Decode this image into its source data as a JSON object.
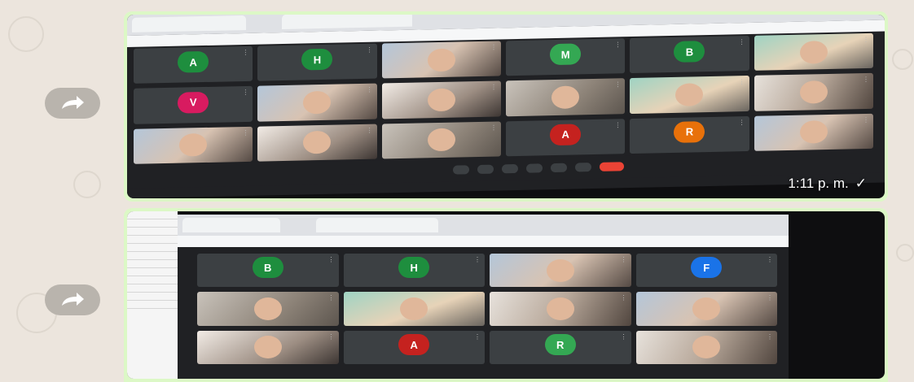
{
  "messages": [
    {
      "time": "1:11 p. m.",
      "status_icon": "check-icon",
      "meeting": {
        "tiles": [
          {
            "type": "avatar",
            "letter": "A",
            "color": "#1e8e3e"
          },
          {
            "type": "avatar",
            "letter": "H",
            "color": "#1e8e3e"
          },
          {
            "type": "video"
          },
          {
            "type": "avatar",
            "letter": "M",
            "color": "#34a853"
          },
          {
            "type": "avatar",
            "letter": "B",
            "color": "#1e8e3e"
          },
          {
            "type": "video"
          },
          {
            "type": "avatar",
            "letter": "V",
            "color": "#d81b60"
          },
          {
            "type": "video"
          },
          {
            "type": "video"
          },
          {
            "type": "video"
          },
          {
            "type": "video"
          },
          {
            "type": "video"
          },
          {
            "type": "video"
          },
          {
            "type": "video"
          },
          {
            "type": "video"
          },
          {
            "type": "avatar",
            "letter": "A",
            "color": "#c5221f"
          },
          {
            "type": "avatar",
            "letter": "R",
            "color": "#e8710a"
          },
          {
            "type": "video"
          }
        ]
      }
    },
    {
      "meeting": {
        "tiles": [
          {
            "type": "avatar",
            "letter": "B",
            "color": "#1e8e3e"
          },
          {
            "type": "avatar",
            "letter": "H",
            "color": "#1e8e3e"
          },
          {
            "type": "video"
          },
          {
            "type": "avatar",
            "letter": "F",
            "color": "#1a73e8"
          },
          {
            "type": "video"
          },
          {
            "type": "video"
          },
          {
            "type": "video"
          },
          {
            "type": "video"
          },
          {
            "type": "video"
          },
          {
            "type": "avatar",
            "letter": "A",
            "color": "#c5221f"
          },
          {
            "type": "avatar",
            "letter": "R",
            "color": "#34a853"
          },
          {
            "type": "video"
          }
        ]
      }
    }
  ],
  "icons": {
    "forward": "forward-arrow-icon"
  },
  "colors": {
    "bubble": "#dcf8c6",
    "chat_bg": "#ece5dd",
    "meet_bg": "#202124",
    "tile_bg": "#3c4043",
    "hangup": "#ea4335"
  }
}
